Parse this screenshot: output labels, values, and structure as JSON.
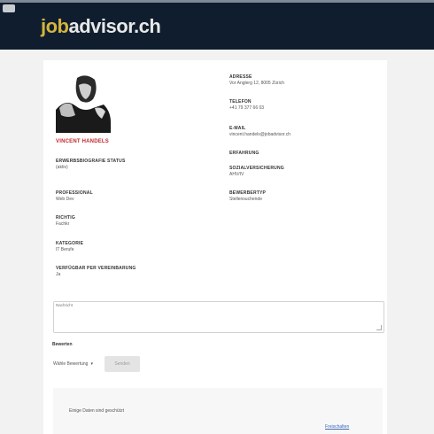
{
  "brand": {
    "logo_part1": "job",
    "logo_part2": "advisor.ch",
    "accent": "#d5b43c",
    "header_bg": "#0f1d2e"
  },
  "profile": {
    "name": "VINCENT HANDELS",
    "left_fields": [
      {
        "label": "Erwerbsbiografie status",
        "value": "(aktiv)"
      },
      {
        "label": "Professional",
        "value": "Web Dev"
      },
      {
        "label": "Richtig",
        "value": "Fachkr"
      },
      {
        "label": "Kategorie",
        "value": "IT Berufe"
      },
      {
        "label": "Verfügbar per Vereinbarung",
        "value": "Ja"
      }
    ],
    "right_fields": [
      {
        "label": "Adresse",
        "value": "Vor Anglerg 12, 8005 Zürich"
      },
      {
        "label": "Telefon",
        "value": "+41 79 377 66 03"
      },
      {
        "label": "E-Mail",
        "value": "vincent.handels@jobadvisor.ch"
      },
      {
        "label": "Erfahrung",
        "value": ""
      },
      {
        "label": "Sozialversicherung",
        "value": "AHV/IV"
      },
      {
        "label": "Bewerbertyp",
        "value": "Stellensuchende"
      }
    ]
  },
  "message": {
    "label": "Nachricht"
  },
  "rating": {
    "label": "Bewerten",
    "select_value": "Wähle Bewertung",
    "send_label": "Senden"
  },
  "note": {
    "text": "Einige Daten sind geschützt",
    "link": "Freischalten"
  }
}
